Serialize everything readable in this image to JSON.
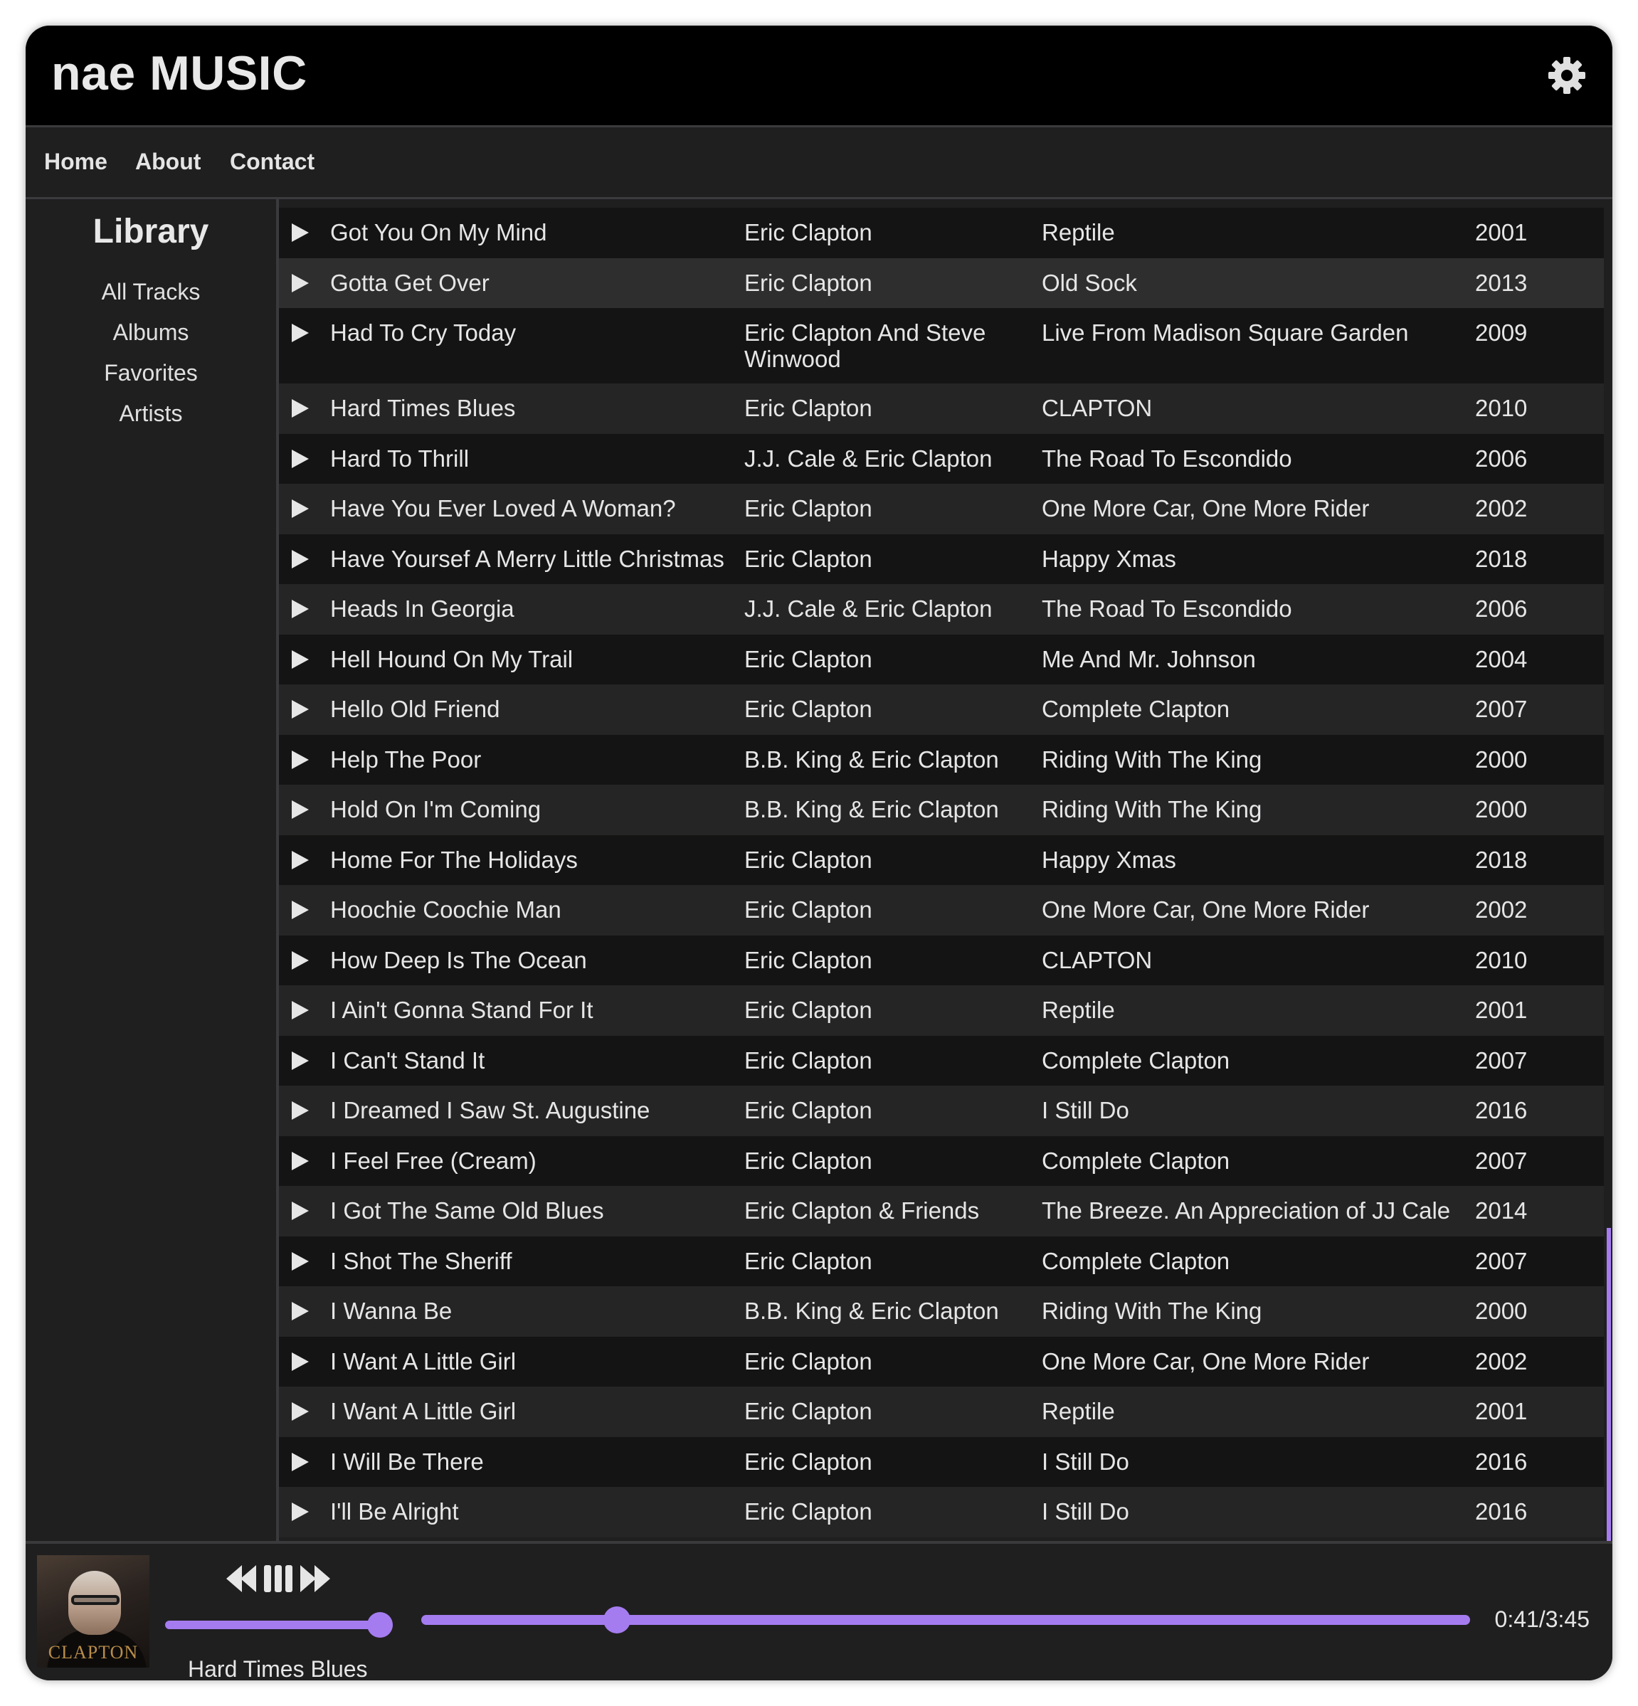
{
  "app": {
    "title": "nae MUSIC",
    "accent": "#a57cf0"
  },
  "nav": {
    "items": [
      "Home",
      "About",
      "Contact"
    ]
  },
  "sidebar": {
    "title": "Library",
    "items": [
      "All Tracks",
      "Albums",
      "Favorites",
      "Artists"
    ]
  },
  "tracks": [
    {
      "title": "Got You On My Mind",
      "artist": "Eric Clapton",
      "album": "Reptile",
      "year": "2001"
    },
    {
      "title": "Gotta Get Over",
      "artist": "Eric Clapton",
      "album": "Old Sock",
      "year": "2013"
    },
    {
      "title": "Had To Cry Today",
      "artist": "Eric Clapton And Steve Winwood",
      "album": "Live From Madison Square Garden",
      "year": "2009"
    },
    {
      "title": "Hard Times Blues",
      "artist": "Eric Clapton",
      "album": "CLAPTON",
      "year": "2010"
    },
    {
      "title": "Hard To Thrill",
      "artist": "J.J. Cale & Eric Clapton",
      "album": "The Road To Escondido",
      "year": "2006"
    },
    {
      "title": "Have You Ever Loved A Woman?",
      "artist": "Eric Clapton",
      "album": "One More Car, One More Rider",
      "year": "2002"
    },
    {
      "title": "Have Yoursef A Merry Little Christmas",
      "artist": "Eric Clapton",
      "album": "Happy Xmas",
      "year": "2018"
    },
    {
      "title": "Heads In Georgia",
      "artist": "J.J. Cale & Eric Clapton",
      "album": "The Road To Escondido",
      "year": "2006"
    },
    {
      "title": "Hell Hound On My Trail",
      "artist": "Eric Clapton",
      "album": "Me And Mr. Johnson",
      "year": "2004"
    },
    {
      "title": "Hello Old Friend",
      "artist": "Eric Clapton",
      "album": "Complete Clapton",
      "year": "2007"
    },
    {
      "title": "Help The Poor",
      "artist": "B.B. King & Eric Clapton",
      "album": "Riding With The King",
      "year": "2000"
    },
    {
      "title": "Hold On I'm Coming",
      "artist": "B.B. King & Eric Clapton",
      "album": "Riding With The King",
      "year": "2000"
    },
    {
      "title": "Home For The Holidays",
      "artist": "Eric Clapton",
      "album": "Happy Xmas",
      "year": "2018"
    },
    {
      "title": "Hoochie Coochie Man",
      "artist": "Eric Clapton",
      "album": "One More Car, One More Rider",
      "year": "2002"
    },
    {
      "title": "How Deep Is The Ocean",
      "artist": "Eric Clapton",
      "album": "CLAPTON",
      "year": "2010"
    },
    {
      "title": "I Ain't Gonna Stand For It",
      "artist": "Eric Clapton",
      "album": "Reptile",
      "year": "2001"
    },
    {
      "title": "I Can't Stand It",
      "artist": "Eric Clapton",
      "album": "Complete Clapton",
      "year": "2007"
    },
    {
      "title": "I Dreamed I Saw St. Augustine",
      "artist": "Eric Clapton",
      "album": "I Still Do",
      "year": "2016"
    },
    {
      "title": "I Feel Free (Cream)",
      "artist": "Eric Clapton",
      "album": "Complete Clapton",
      "year": "2007"
    },
    {
      "title": "I Got The Same Old Blues",
      "artist": "Eric Clapton & Friends",
      "album": "The Breeze. An Appreciation of JJ Cale",
      "year": "2014"
    },
    {
      "title": "I Shot The Sheriff",
      "artist": "Eric Clapton",
      "album": "Complete Clapton",
      "year": "2007"
    },
    {
      "title": "I Wanna Be",
      "artist": "B.B. King & Eric Clapton",
      "album": "Riding With The King",
      "year": "2000"
    },
    {
      "title": "I Want A Little Girl",
      "artist": "Eric Clapton",
      "album": "One More Car, One More Rider",
      "year": "2002"
    },
    {
      "title": "I Want A Little Girl",
      "artist": "Eric Clapton",
      "album": "Reptile",
      "year": "2001"
    },
    {
      "title": "I Will Be There",
      "artist": "Eric Clapton",
      "album": "I Still Do",
      "year": "2016"
    },
    {
      "title": "I'll Be Alright",
      "artist": "Eric Clapton",
      "album": "I Still Do",
      "year": "2016"
    }
  ],
  "player": {
    "cover_text": "CLAPTON",
    "now_playing": "Hard Times Blues",
    "time": "0:41/3:45",
    "progress": 0.182,
    "volume": 0.95,
    "controls": [
      "previous-icon",
      "pause-icon",
      "next-icon"
    ]
  }
}
